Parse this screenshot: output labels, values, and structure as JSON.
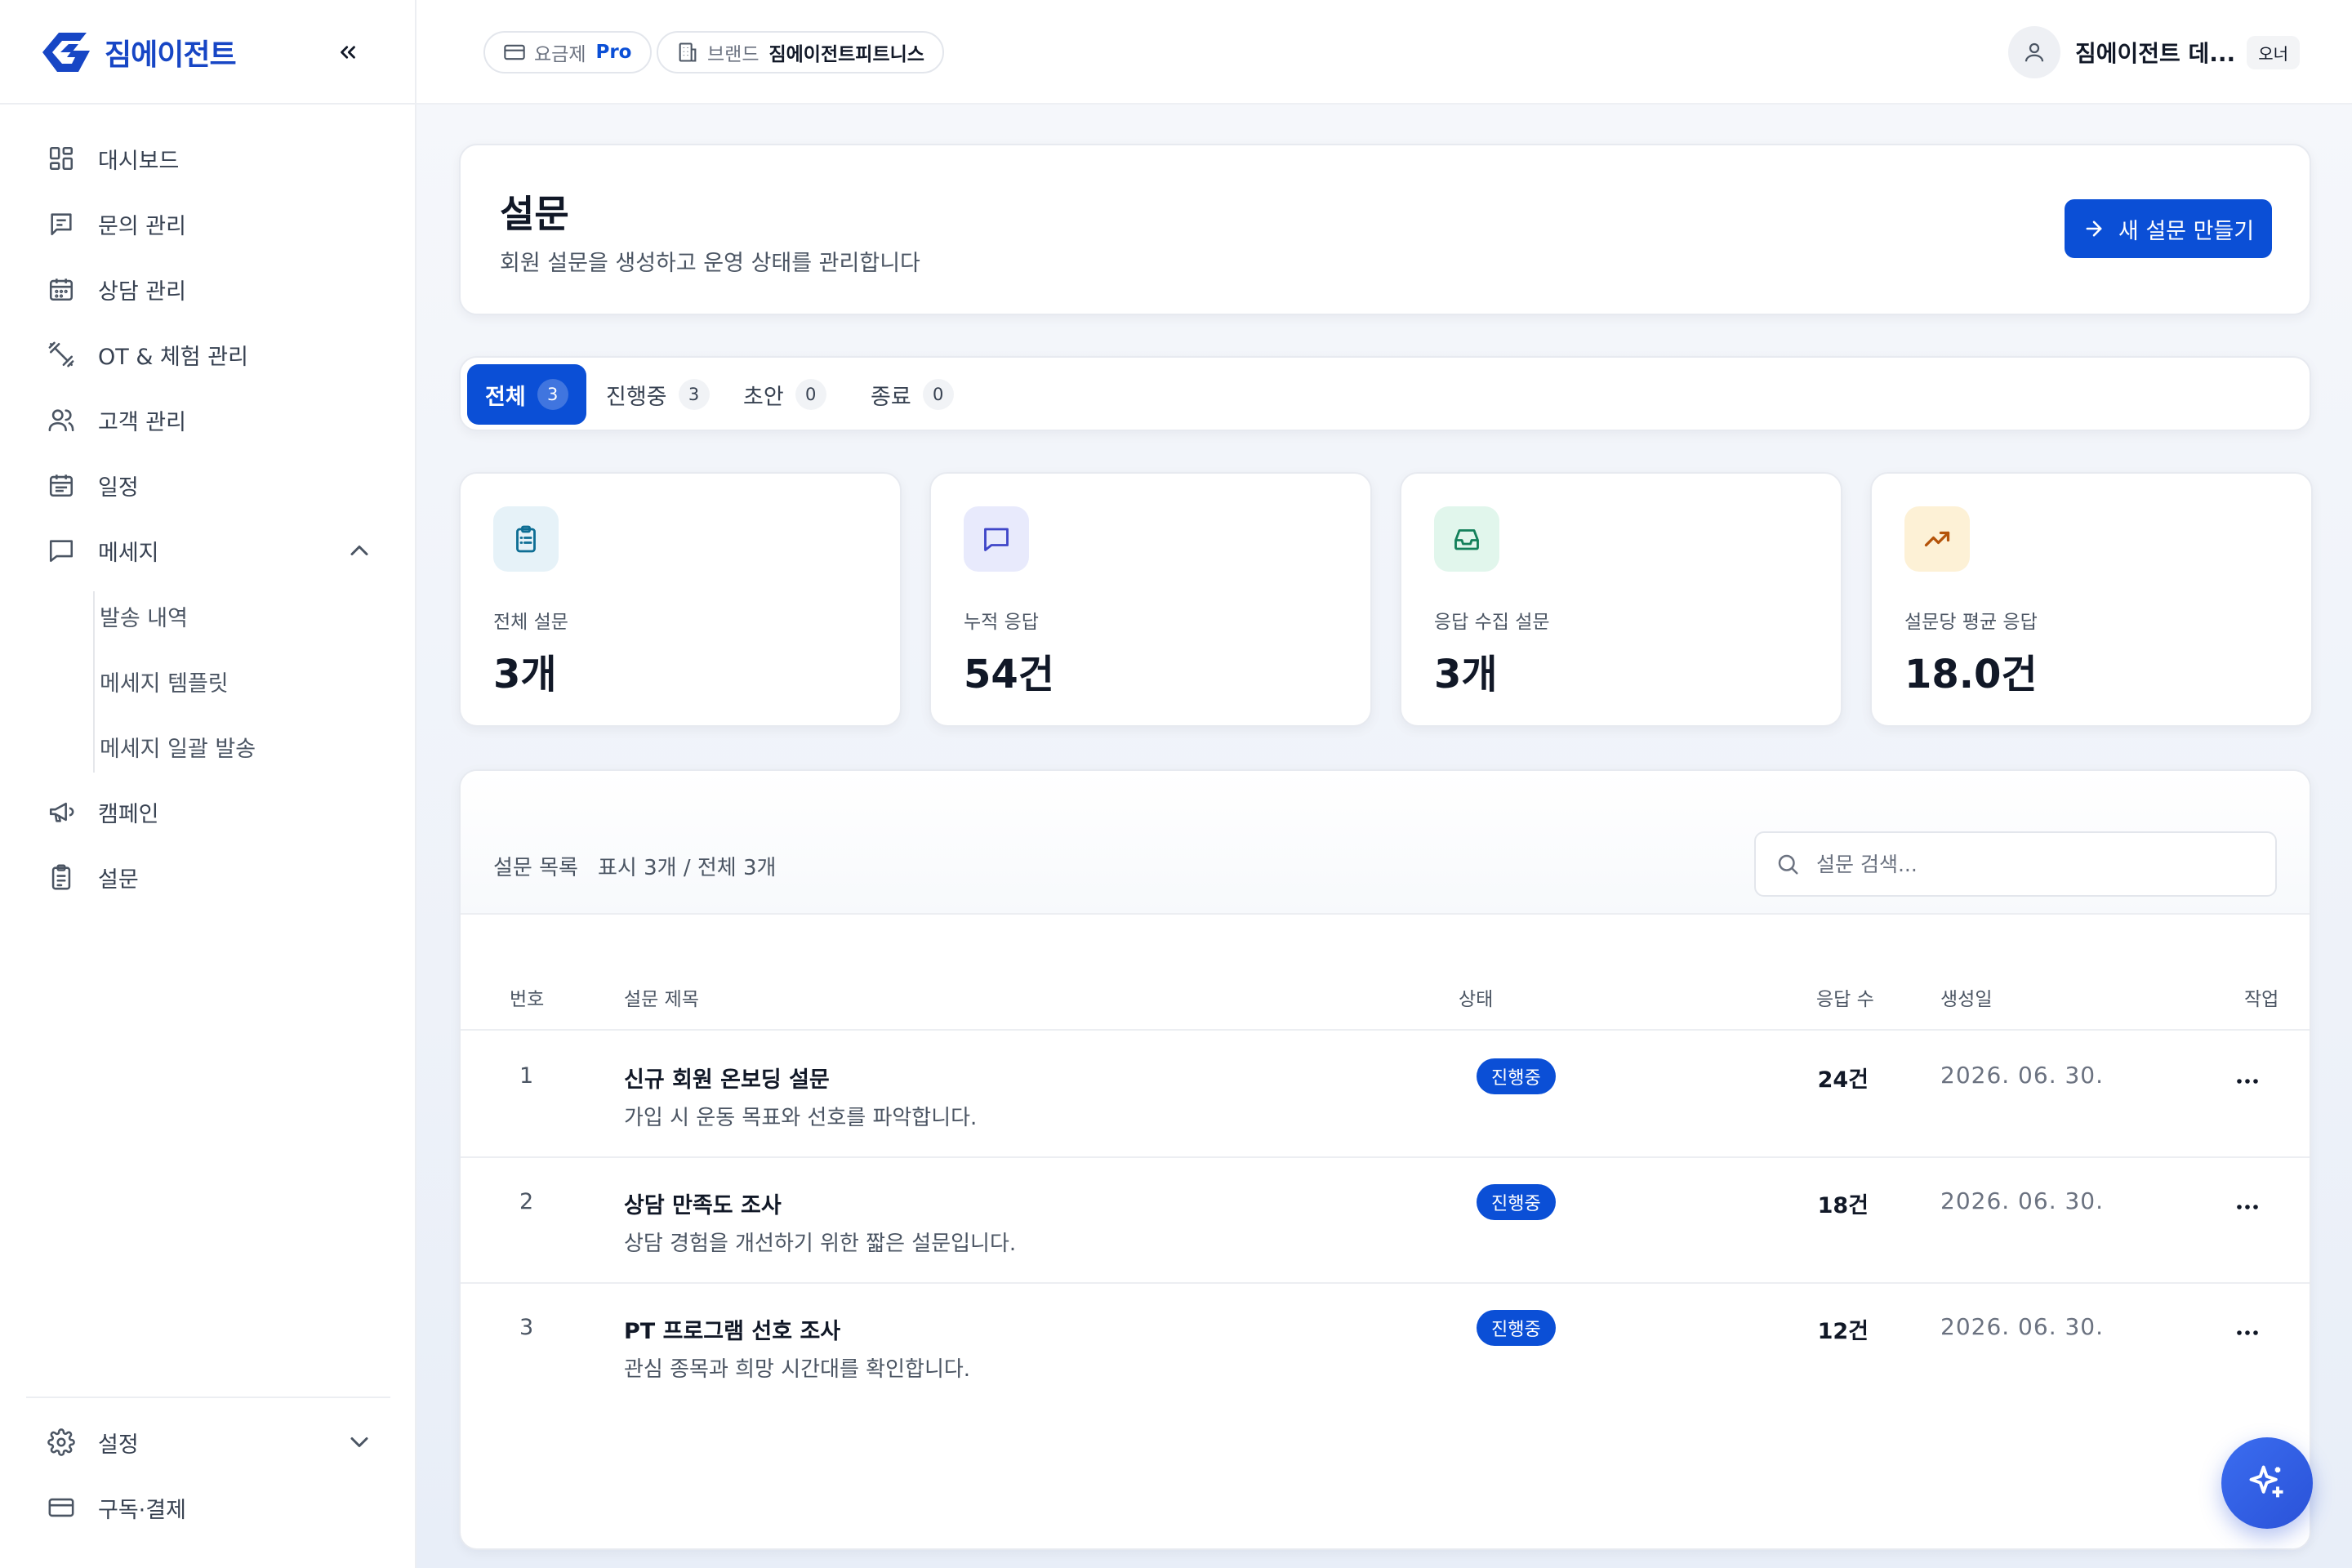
{
  "brand": {
    "name": "짐에이전트",
    "accent": "#0b4fd6",
    "logo_color": "#1746c5"
  },
  "sidebar": {
    "collapse_icon": "double-chevron-left-icon",
    "items": [
      {
        "label": "대시보드",
        "icon": "dashboard-grid-icon"
      },
      {
        "label": "문의 관리",
        "icon": "message-square-icon"
      },
      {
        "label": "상담 관리",
        "icon": "calendar-icon"
      },
      {
        "label": "OT & 체험 관리",
        "icon": "dumbbell-icon"
      },
      {
        "label": "고객 관리",
        "icon": "users-icon"
      },
      {
        "label": "일정",
        "icon": "calendar-days-icon"
      },
      {
        "label": "메세지",
        "icon": "chat-bubble-icon",
        "expanded": true
      },
      {
        "label": "캠페인",
        "icon": "megaphone-icon"
      },
      {
        "label": "설문",
        "icon": "clipboard-icon"
      }
    ],
    "message_sub": [
      "발송 내역",
      "메세지 템플릿",
      "메세지 일괄 발송"
    ],
    "bottom": [
      {
        "label": "설정",
        "icon": "gear-icon"
      },
      {
        "label": "구독·결제",
        "icon": "credit-card-icon"
      }
    ]
  },
  "topbar": {
    "plan_label": "요금제",
    "plan_value": "Pro",
    "brand_label": "브랜드",
    "brand_value": "짐에이전트피트니스",
    "user_name": "짐에이전트 데...",
    "user_role": "오너"
  },
  "header": {
    "title": "설문",
    "subtitle": "회원 설문을 생성하고 운영 상태를 관리합니다",
    "new_button": "새 설문 만들기"
  },
  "tabs": [
    {
      "label": "전체",
      "count": "3",
      "active": true
    },
    {
      "label": "진행중",
      "count": "3"
    },
    {
      "label": "초안",
      "count": "0"
    },
    {
      "label": "종료",
      "count": "0"
    }
  ],
  "stats": [
    {
      "label": "전체 설문",
      "value": "3개",
      "icon": "clipboard-list-icon",
      "bg": "#e6f2f8",
      "fg": "#0e6e94"
    },
    {
      "label": "누적 응답",
      "value": "54건",
      "icon": "message-square-icon",
      "bg": "#e8eafc",
      "fg": "#3f46c8"
    },
    {
      "label": "응답 수집 설문",
      "value": "3개",
      "icon": "inbox-icon",
      "bg": "#e1f6ec",
      "fg": "#13805a"
    },
    {
      "label": "설문당 평균 응답",
      "value": "18.0건",
      "icon": "trending-up-icon",
      "bg": "#fdf1d6",
      "fg": "#b45309"
    }
  ],
  "list": {
    "title": "설문 목록",
    "count_text": "표시 3개 / 전체 3개",
    "search_placeholder": "설문 검색...",
    "columns": {
      "no": "번호",
      "title": "설문 제목",
      "status": "상태",
      "responses": "응답 수",
      "created": "생성일",
      "actions": "작업"
    },
    "rows": [
      {
        "no": "1",
        "title": "신규 회원 온보딩 설문",
        "desc": "가입 시 운동 목표와 선호를 파악합니다.",
        "status": "진행중",
        "responses": "24건",
        "created": "2026. 06. 30."
      },
      {
        "no": "2",
        "title": "상담 만족도 조사",
        "desc": "상담 경험을 개선하기 위한 짧은 설문입니다.",
        "status": "진행중",
        "responses": "18건",
        "created": "2026. 06. 30."
      },
      {
        "no": "3",
        "title": "PT 프로그램 선호 조사",
        "desc": "관심 종목과 희망 시간대를 확인합니다.",
        "status": "진행중",
        "responses": "12건",
        "created": "2026. 06. 30."
      }
    ]
  },
  "fab_icon": "sparkles-icon"
}
